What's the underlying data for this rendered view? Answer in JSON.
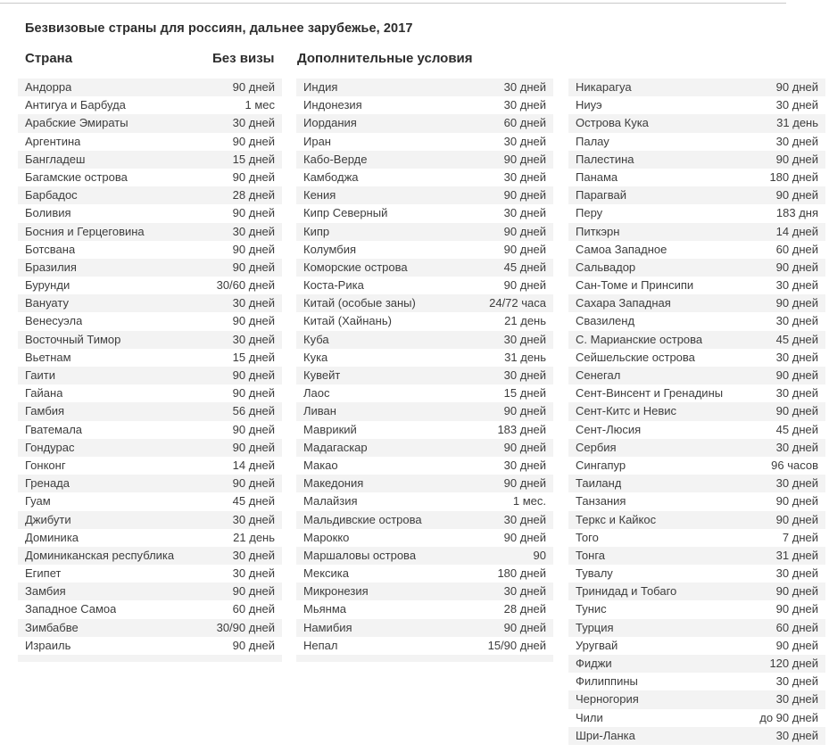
{
  "page": {
    "title": "Безвизовые страны для россиян, дальнее зарубежье, 2017",
    "row_stripe_color": "#f3f3f3",
    "row_base_color": "#ffffff",
    "rule_color": "#c9c9c9",
    "text_color": "#3d3d3d"
  },
  "headers": {
    "country": "Страна",
    "visa_free": "Без визы",
    "extra_conditions": "Дополнительные условия"
  },
  "columns": [
    {
      "id": "left",
      "rows": [
        {
          "country": "Андорра",
          "term": "90 дней"
        },
        {
          "country": "Антигуа и Барбуда",
          "term": "1 мес"
        },
        {
          "country": "Арабские Эмираты",
          "term": "30 дней"
        },
        {
          "country": "Аргентина",
          "term": "90 дней"
        },
        {
          "country": "Бангладеш",
          "term": "15 дней"
        },
        {
          "country": "Багамские острова",
          "term": "90 дней"
        },
        {
          "country": "Барбадос",
          "term": "28 дней"
        },
        {
          "country": "Боливия",
          "term": "90 дней"
        },
        {
          "country": "Босния и Герцеговина",
          "term": "30 дней"
        },
        {
          "country": "Ботсвана",
          "term": "90 дней"
        },
        {
          "country": "Бразилия",
          "term": "90 дней"
        },
        {
          "country": "Бурунди",
          "term": "30/60 дней"
        },
        {
          "country": "Вануату",
          "term": "30 дней"
        },
        {
          "country": "Венесуэла",
          "term": "90 дней"
        },
        {
          "country": "Восточный Тимор",
          "term": "30 дней"
        },
        {
          "country": "Вьетнам",
          "term": "15 дней"
        },
        {
          "country": "Гаити",
          "term": "90 дней"
        },
        {
          "country": "Гайана",
          "term": "90 дней"
        },
        {
          "country": "Гамбия",
          "term": "56 дней"
        },
        {
          "country": "Гватемала",
          "term": "90 дней"
        },
        {
          "country": "Гондурас",
          "term": "90 дней"
        },
        {
          "country": "Гонконг",
          "term": "14 дней"
        },
        {
          "country": "Гренада",
          "term": "90 дней"
        },
        {
          "country": "Гуам",
          "term": "45 дней"
        },
        {
          "country": "Джибути",
          "term": "30 дней"
        },
        {
          "country": "Доминика",
          "term": "21 день"
        },
        {
          "country": "Доминиканская республика",
          "term": "30 дней"
        },
        {
          "country": "Египет",
          "term": "30 дней"
        },
        {
          "country": "Замбия",
          "term": "90 дней"
        },
        {
          "country": "Западное Самоа",
          "term": "60 дней"
        },
        {
          "country": "Зимбабве",
          "term": "30/90 дней"
        },
        {
          "country": "Израиль",
          "term": "90 дней"
        }
      ]
    },
    {
      "id": "middle",
      "rows": [
        {
          "country": "Индия",
          "term": "30 дней"
        },
        {
          "country": "Индонезия",
          "term": "30 дней"
        },
        {
          "country": "Иордания",
          "term": "60 дней"
        },
        {
          "country": "Иран",
          "term": "30 дней"
        },
        {
          "country": "Кабо-Верде",
          "term": "90 дней"
        },
        {
          "country": "Камбоджа",
          "term": "30 дней"
        },
        {
          "country": "Кения",
          "term": "90 дней"
        },
        {
          "country": "Кипр Северный",
          "term": "30 дней"
        },
        {
          "country": "Кипр",
          "term": "90 дней"
        },
        {
          "country": "Колумбия",
          "term": "90 дней"
        },
        {
          "country": "Коморские острова",
          "term": "45 дней"
        },
        {
          "country": "Коста-Рика",
          "term": "90 дней"
        },
        {
          "country": "Китай (особые заны)",
          "term": "24/72 часа"
        },
        {
          "country": "Китай (Хайнань)",
          "term": "21 день"
        },
        {
          "country": "Куба",
          "term": "30 дней"
        },
        {
          "country": "Кука",
          "term": "31 день"
        },
        {
          "country": "Кувейт",
          "term": "30 дней"
        },
        {
          "country": "Лаос",
          "term": "15 дней"
        },
        {
          "country": "Ливан",
          "term": "90 дней"
        },
        {
          "country": "Маврикий",
          "term": "183 дней"
        },
        {
          "country": "Мадагаскар",
          "term": "90 дней"
        },
        {
          "country": "Макао",
          "term": "30 дней"
        },
        {
          "country": "Македония",
          "term": "90 дней"
        },
        {
          "country": "Малайзия",
          "term": "1 мес."
        },
        {
          "country": "Мальдивские острова",
          "term": "30 дней"
        },
        {
          "country": "Марокко",
          "term": "90 дней"
        },
        {
          "country": "Маршаловы острова",
          "term": "90"
        },
        {
          "country": "Мексика",
          "term": "180 дней"
        },
        {
          "country": "Микронезия",
          "term": "30 дней"
        },
        {
          "country": "Мьянма",
          "term": "28 дней"
        },
        {
          "country": "Намибия",
          "term": "90 дней"
        },
        {
          "country": "Непал",
          "term": "15/90 дней"
        }
      ]
    },
    {
      "id": "right",
      "rows": [
        {
          "country": "Никарагуа",
          "term": "90 дней"
        },
        {
          "country": "Ниуэ",
          "term": "30 дней"
        },
        {
          "country": "Острова Кука",
          "term": "31 день"
        },
        {
          "country": "Палау",
          "term": "30 дней"
        },
        {
          "country": "Палестина",
          "term": "90 дней"
        },
        {
          "country": "Панама",
          "term": "180 дней"
        },
        {
          "country": "Парагвай",
          "term": "90 дней"
        },
        {
          "country": "Перу",
          "term": "183 дня"
        },
        {
          "country": "Питкэрн",
          "term": "14 дней"
        },
        {
          "country": "Самоа Западное",
          "term": "60 дней"
        },
        {
          "country": "Сальвадор",
          "term": "90 дней"
        },
        {
          "country": "Сан-Томе и Принсипи",
          "term": "30 дней"
        },
        {
          "country": "Сахара Западная",
          "term": "90 дней"
        },
        {
          "country": "Свазиленд",
          "term": "30 дней"
        },
        {
          "country": "С. Марианские острова",
          "term": "45 дней"
        },
        {
          "country": "Сейшельские острова",
          "term": "30 дней"
        },
        {
          "country": "Сенегал",
          "term": "90 дней"
        },
        {
          "country": "Сент-Винсент и Гренадины",
          "term": "30 дней"
        },
        {
          "country": "Сент-Китс и Невис",
          "term": "90 дней"
        },
        {
          "country": "Сент-Люсия",
          "term": "45 дней"
        },
        {
          "country": "Сербия",
          "term": "30 дней"
        },
        {
          "country": "Сингапур",
          "term": "96 часов"
        },
        {
          "country": "Таиланд",
          "term": "30 дней"
        },
        {
          "country": "Танзания",
          "term": "90 дней"
        },
        {
          "country": "Теркс и Кайкос",
          "term": "90 дней"
        },
        {
          "country": "Того",
          "term": "7 дней"
        },
        {
          "country": "Тонга",
          "term": "31 дней"
        },
        {
          "country": "Тувалу",
          "term": "30 дней"
        },
        {
          "country": "Тринидад и Тобаго",
          "term": "90 дней"
        },
        {
          "country": "Тунис",
          "term": "90 дней"
        },
        {
          "country": "Турция",
          "term": "60 дней"
        },
        {
          "country": "Уругвай",
          "term": "90 дней"
        },
        {
          "country": "Фиджи",
          "term": "120 дней"
        },
        {
          "country": "Филиппины",
          "term": "30 дней"
        },
        {
          "country": "Черногория",
          "term": "30 дней"
        },
        {
          "country": "Чили",
          "term": "до 90 дней"
        },
        {
          "country": "Шри-Ланка",
          "term": "30 дней"
        }
      ]
    }
  ]
}
